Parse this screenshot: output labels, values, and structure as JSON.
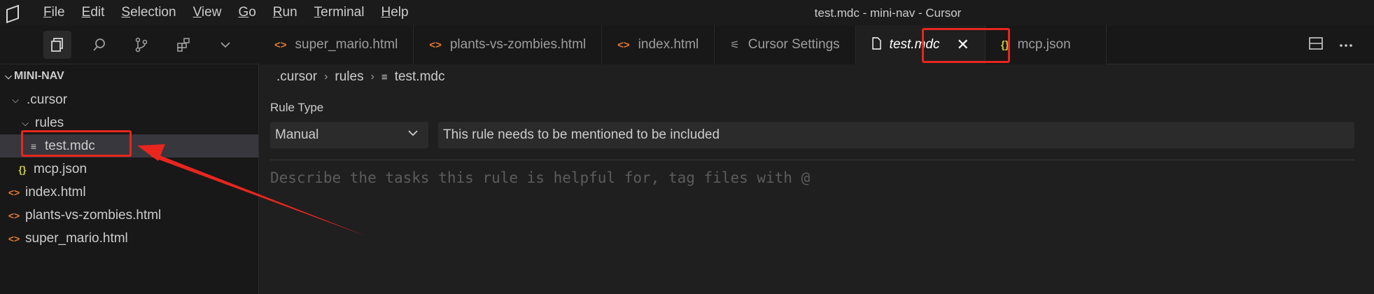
{
  "titlebar": {
    "window_title": "test.mdc - mini-nav - Cursor",
    "menu": [
      {
        "first": "F",
        "rest": "ile"
      },
      {
        "first": "E",
        "rest": "dit"
      },
      {
        "first": "S",
        "rest": "election"
      },
      {
        "first": "V",
        "rest": "iew"
      },
      {
        "first": "G",
        "rest": "o"
      },
      {
        "first": "R",
        "rest": "un"
      },
      {
        "first": "T",
        "rest": "erminal"
      },
      {
        "first": "H",
        "rest": "elp"
      }
    ]
  },
  "activity": {
    "icons": [
      "explorer-icon",
      "search-icon",
      "source-control-icon",
      "extensions-icon",
      "chevron-down-icon"
    ]
  },
  "tabs": [
    {
      "label": "super_mario.html",
      "icon": "<>",
      "type": "html"
    },
    {
      "label": "plants-vs-zombies.html",
      "icon": "<>",
      "type": "html"
    },
    {
      "label": "index.html",
      "icon": "<>",
      "type": "html"
    },
    {
      "label": "Cursor Settings",
      "icon": "⚟",
      "type": "gear"
    },
    {
      "label": "test.mdc",
      "icon": "🗋",
      "type": "file",
      "active": true
    },
    {
      "label": "mcp.json",
      "icon": "{}",
      "type": "json"
    }
  ],
  "close_glyph": "✕",
  "sidebar": {
    "title": "MINI-NAV",
    "tree": [
      {
        "label": ".cursor",
        "icon": "",
        "chev": "⌵",
        "indent": 1
      },
      {
        "label": "rules",
        "icon": "",
        "chev": "⌵",
        "indent": 2
      },
      {
        "label": "test.mdc",
        "icon": "≡",
        "chev": "",
        "indent": 3,
        "selected": true
      },
      {
        "label": "mcp.json",
        "icon": "{}",
        "chev": "",
        "indent": 2
      },
      {
        "label": "index.html",
        "icon": "<>",
        "chev": "",
        "indent": 1
      },
      {
        "label": "plants-vs-zombies.html",
        "icon": "<>",
        "chev": "",
        "indent": 1
      },
      {
        "label": "super_mario.html",
        "icon": "<>",
        "chev": "",
        "indent": 1
      }
    ]
  },
  "breadcrumb": {
    "items": [
      ".cursor",
      "rules",
      "test.mdc"
    ]
  },
  "editor": {
    "rule_type_label": "Rule Type",
    "rule_type_value": "Manual",
    "rule_description": "This rule needs to be mentioned to be included",
    "body_placeholder": "Describe the tasks this rule is helpful for, tag files with @"
  },
  "colors": {
    "annotation_red": "#e8261e",
    "html_icon": "#e37933",
    "json_icon": "#cbcb41"
  }
}
